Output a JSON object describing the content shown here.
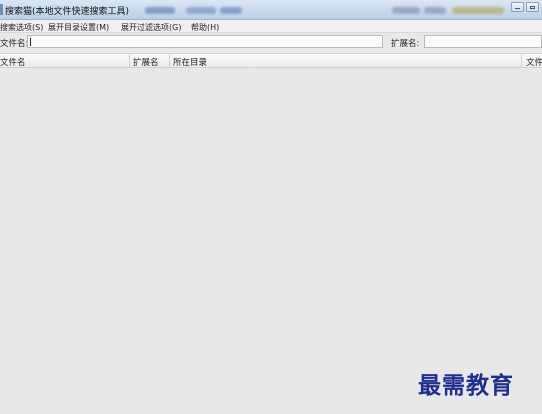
{
  "window": {
    "title": "搜索猫(本地文件快速搜索工具)",
    "controls": [
      {
        "name": "minimize",
        "icon": "minimize-icon"
      },
      {
        "name": "maximize",
        "icon": "maximize-icon"
      }
    ]
  },
  "menu": {
    "items": [
      {
        "label": "搜索选项(S)"
      },
      {
        "label": "展开目录设置(M)"
      },
      {
        "label": "展开过滤选项(G)"
      },
      {
        "label": "帮助(H)"
      }
    ]
  },
  "search": {
    "filename_label": "文件名:",
    "filename_value": "",
    "extension_label": "扩展名:",
    "extension_value": ""
  },
  "table": {
    "columns": [
      {
        "label": "文件名"
      },
      {
        "label": "扩展名"
      },
      {
        "label": "所在目录"
      },
      {
        "label": "文件"
      }
    ],
    "rows": []
  },
  "watermark": {
    "text": "最需教育"
  },
  "colors": {
    "titlebar": "#c9d9ec",
    "background": "#ececec",
    "watermark": "#1f2f8f"
  }
}
